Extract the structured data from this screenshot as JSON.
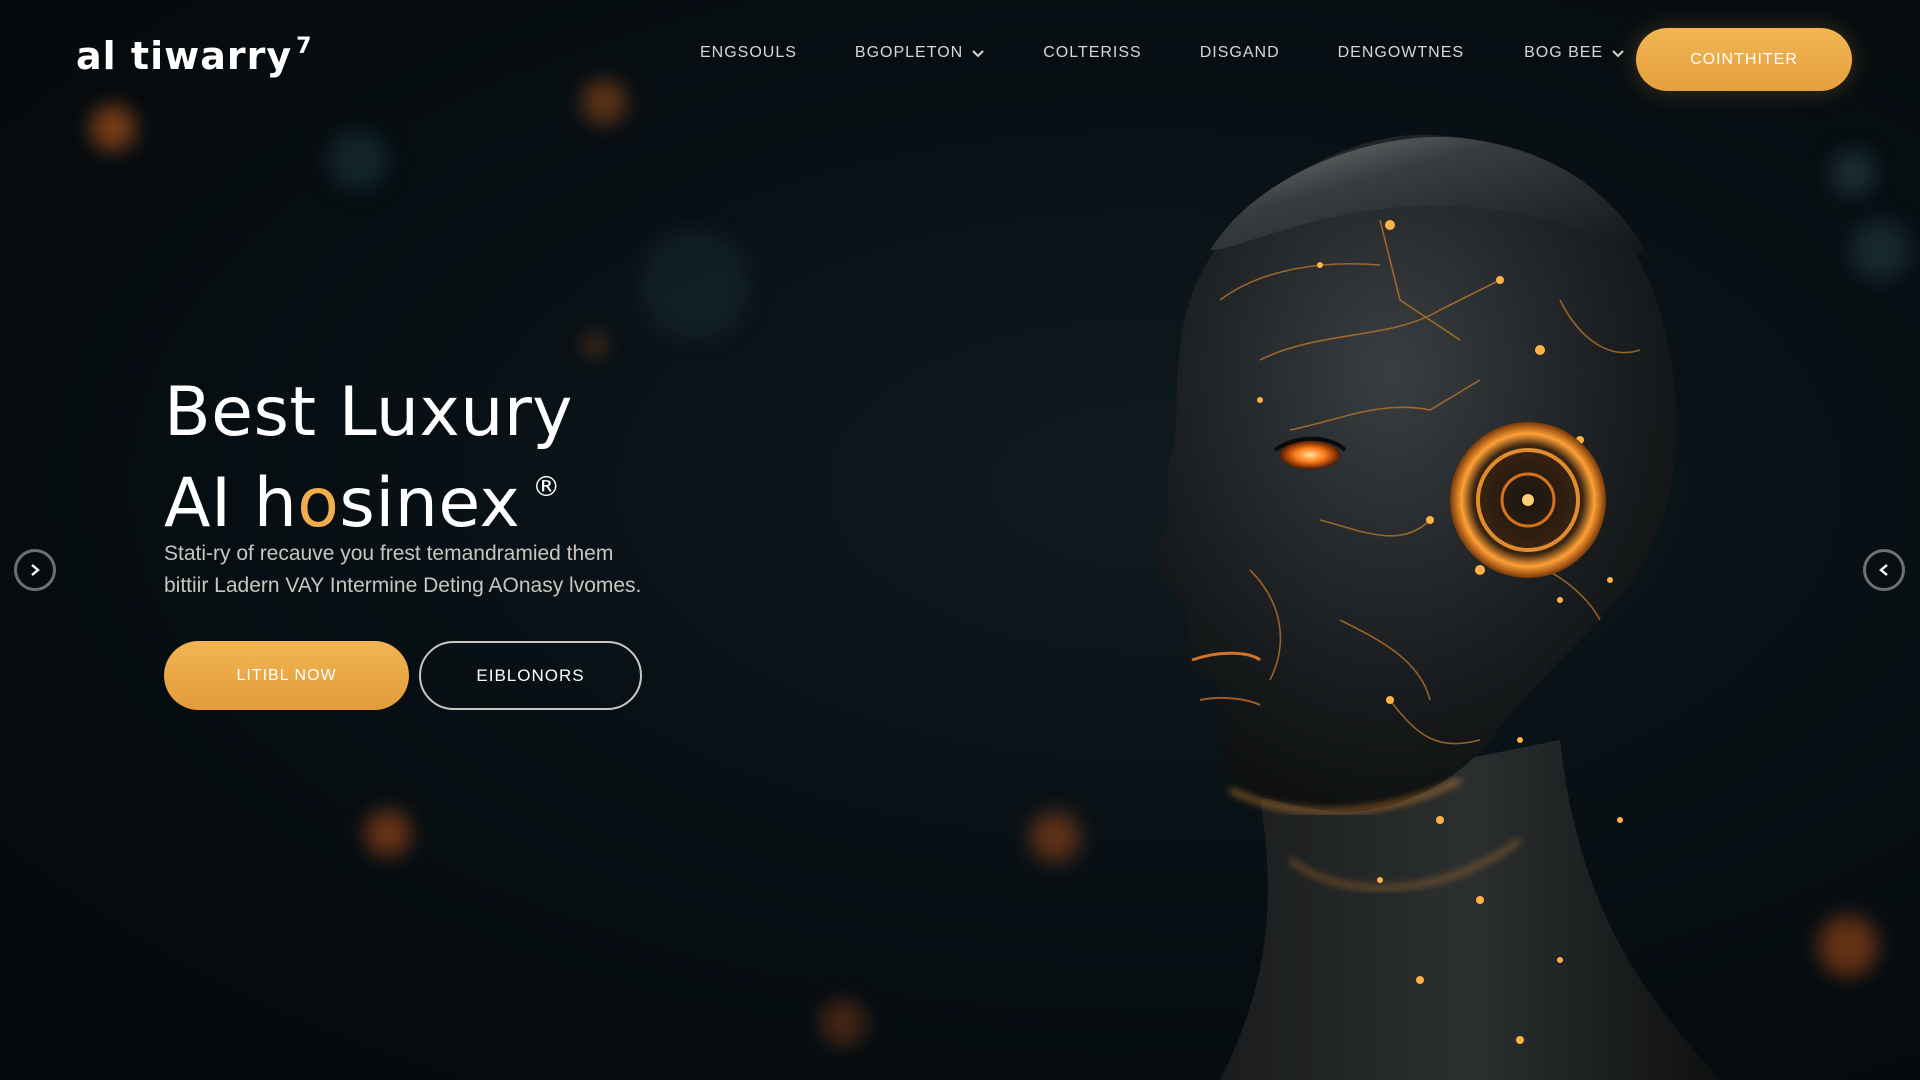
{
  "header": {
    "logo_text": "al tiwarry",
    "logo_mark": "7",
    "nav": [
      {
        "label": "ENGSOULS",
        "dropdown": false
      },
      {
        "label": "BGOPLETON",
        "dropdown": true
      },
      {
        "label": "COLTERISS",
        "dropdown": false
      },
      {
        "label": "DISGAND",
        "dropdown": false
      },
      {
        "label": "DENGOWTNES",
        "dropdown": false
      },
      {
        "label": "BOG BEE",
        "dropdown": true
      }
    ],
    "cta_label": "COINTHITER"
  },
  "hero": {
    "title_line1": "Best Luxury",
    "title_line2_a": "AI h",
    "title_line2_o": "o",
    "title_line2_b": "sinex",
    "title_mark": "®",
    "subtitle_line1": "Stati-ry of recauve you frest temandramied them",
    "subtitle_line2": "bittiir Ladern VAY Intermine Deting AOnasy lvomes.",
    "primary_button": "LITIBL NOW",
    "secondary_button": "EIBLONORS"
  },
  "carousel": {
    "prev_icon": "chevron-right-icon",
    "next_icon": "chevron-left-icon"
  },
  "colors": {
    "accent": "#f0ad4e",
    "background": "#071015",
    "glow": "#ff9a2e"
  }
}
